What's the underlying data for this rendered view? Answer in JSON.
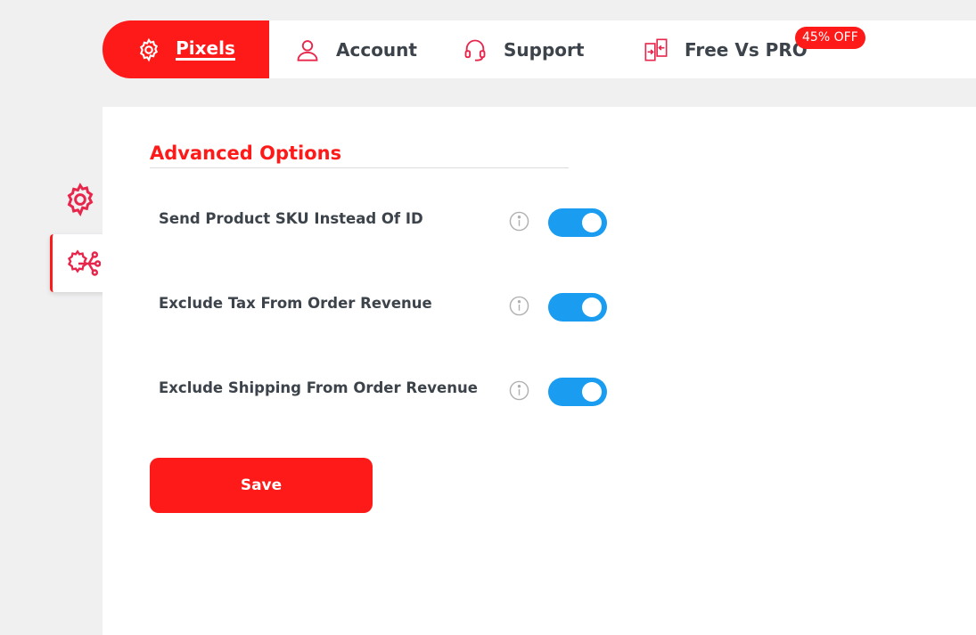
{
  "nav": {
    "tabs": [
      {
        "label": "Pixels",
        "icon": "gear-icon",
        "active": true
      },
      {
        "label": "Account",
        "icon": "user-icon",
        "active": false
      },
      {
        "label": "Support",
        "icon": "headset-icon",
        "active": false
      },
      {
        "label": "Free Vs PRO",
        "icon": "compare-icon",
        "active": false
      }
    ],
    "pro_badge": "45% OFF"
  },
  "sidebar": {
    "items": [
      {
        "icon": "gear-icon",
        "active": false
      },
      {
        "icon": "advanced-network-icon",
        "active": true
      }
    ]
  },
  "section": {
    "title": "Advanced Options",
    "options": [
      {
        "label": "Send Product SKU Instead Of ID",
        "enabled": true
      },
      {
        "label": "Exclude Tax From Order Revenue",
        "enabled": true
      },
      {
        "label": "Exclude Shipping From Order Revenue",
        "enabled": true
      }
    ]
  },
  "save_label": "Save",
  "colors": {
    "accent": "#ff1a1a",
    "toggle_on": "#1a9cf0",
    "text": "#3c434a",
    "background": "#f0f0f1"
  }
}
